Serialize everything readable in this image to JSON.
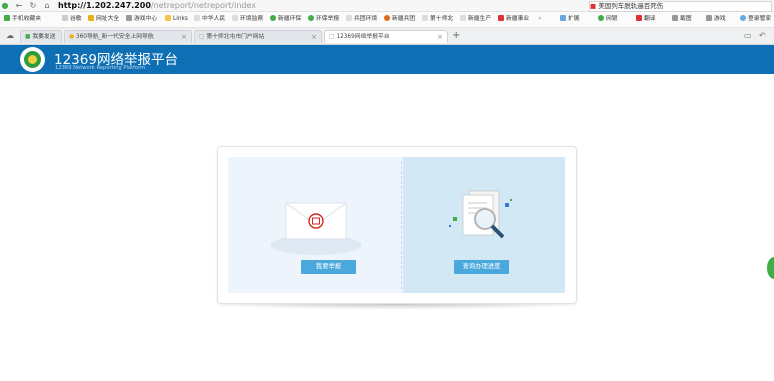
{
  "browser": {
    "url_host": "http://1.202.247.200",
    "url_path": "/netreport/netreport/index",
    "search_text": "美国列车脱轨遍百死伤",
    "right_tools": [
      "扩展",
      "网银",
      "翻译",
      "截图",
      "游戏",
      "登录管家"
    ],
    "bookmarks": [
      "手机收藏夹",
      "谷歌",
      "网址大全",
      "游戏中心",
      "Links",
      "中华人民",
      "环境监察",
      "新疆环保",
      "环保举报",
      "兵团环境",
      "新疆兵团",
      "第十师北",
      "新疆生产",
      "新疆事业"
    ],
    "tabs": [
      {
        "label": "我要发送"
      },
      {
        "label": "360导航_新一代安全上网导航"
      },
      {
        "label": "第十师北屯市门户网站"
      },
      {
        "label": "12369网络举报平台"
      }
    ],
    "new_tab_label": "+"
  },
  "site": {
    "title": "12369网络举报平台",
    "subtitle": "12369 Network Reporting Platform"
  },
  "panel": {
    "report_button": "我要举报",
    "query_button": "查询办理进度"
  },
  "colors": {
    "header_bg": "#0e6fb5",
    "button_bg": "#4aa8dc",
    "left_bg": "#eef4fb",
    "right_bg": "#d3e8f5"
  },
  "icons": [
    "back-icon",
    "forward-icon",
    "refresh-icon",
    "home-icon",
    "envelope-icon",
    "document-magnifier-icon"
  ]
}
